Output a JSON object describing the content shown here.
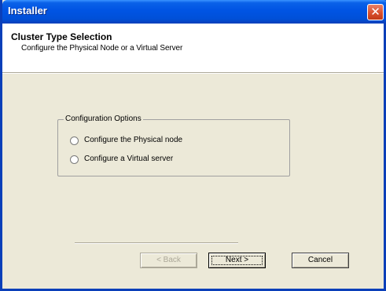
{
  "window": {
    "title": "Installer",
    "close_glyph": "✕"
  },
  "header": {
    "title": "Cluster Type Selection",
    "subtitle": "Configure the Physical Node or a Virtual Server"
  },
  "options": {
    "group_label": "Configuration Options",
    "items": [
      {
        "label": "Configure the Physical node",
        "selected": false
      },
      {
        "label": "Configure a Virtual server",
        "selected": false
      }
    ]
  },
  "buttons": {
    "back": "< Back",
    "next": "Next >",
    "cancel": "Cancel"
  },
  "colors": {
    "titlebar": "#0054e3",
    "dialog_bg": "#ece9d8",
    "close_button": "#d9502e"
  }
}
